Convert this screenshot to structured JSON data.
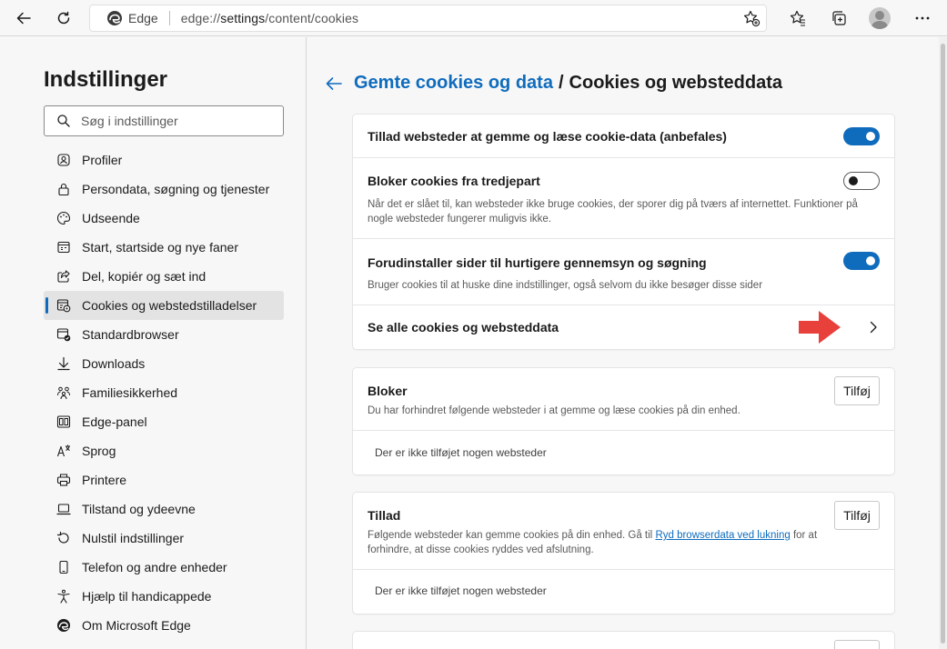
{
  "browser": {
    "address_brand": "Edge",
    "address_url_prefix": "edge://",
    "address_url_host": "settings",
    "address_url_path": "/content/cookies"
  },
  "sidebar": {
    "title": "Indstillinger",
    "search_placeholder": "Søg i indstillinger",
    "items": [
      {
        "label": "Profiler",
        "icon": "profile-icon"
      },
      {
        "label": "Persondata, søgning og tjenester",
        "icon": "lock-icon"
      },
      {
        "label": "Udseende",
        "icon": "palette-icon"
      },
      {
        "label": "Start, startside og nye faner",
        "icon": "new-tab-icon"
      },
      {
        "label": "Del, kopiér og sæt ind",
        "icon": "share-icon"
      },
      {
        "label": "Cookies og webstedstilladelser",
        "icon": "site-permissions-icon",
        "active": true
      },
      {
        "label": "Standardbrowser",
        "icon": "default-browser-icon"
      },
      {
        "label": "Downloads",
        "icon": "download-icon"
      },
      {
        "label": "Familiesikkerhed",
        "icon": "family-icon"
      },
      {
        "label": "Edge-panel",
        "icon": "sidebar-panel-icon"
      },
      {
        "label": "Sprog",
        "icon": "language-icon"
      },
      {
        "label": "Printere",
        "icon": "printer-icon"
      },
      {
        "label": "Tilstand og ydeevne",
        "icon": "laptop-icon"
      },
      {
        "label": "Nulstil indstillinger",
        "icon": "reset-icon"
      },
      {
        "label": "Telefon og andre enheder",
        "icon": "phone-icon"
      },
      {
        "label": "Hjælp til handicappede",
        "icon": "accessibility-icon"
      },
      {
        "label": "Om Microsoft Edge",
        "icon": "edge-logo-icon"
      }
    ]
  },
  "main": {
    "breadcrumb_parent": "Gemte cookies og data",
    "breadcrumb_separator": "/",
    "breadcrumb_current": "Cookies og websteddata",
    "settings": {
      "allow": {
        "label": "Tillad websteder at gemme og læse cookie-data (anbefales)",
        "enabled": true
      },
      "block_third_party": {
        "label": "Bloker cookies fra tredjepart",
        "description": "Når det er slået til, kan websteder ikke bruge cookies, der sporer dig på tværs af internettet. Funktioner på nogle websteder fungerer muligvis ikke.",
        "enabled": false
      },
      "preload": {
        "label": "Forudinstaller sider til hurtigere gennemsyn og søgning",
        "description": "Bruger cookies til at huske dine indstillinger, også selvom du ikke besøger disse sider",
        "enabled": true
      },
      "see_all": {
        "label": "Se alle cookies og websteddata"
      }
    },
    "block": {
      "title": "Bloker",
      "description": "Du har forhindret følgende websteder i at gemme og læse cookies på din enhed.",
      "add_label": "Tilføj",
      "empty_text": "Der er ikke tilføjet nogen websteder"
    },
    "allow": {
      "title": "Tillad",
      "description_before": "Følgende websteder kan gemme cookies på din enhed. Gå til ",
      "description_link": "Ryd browserdata ved lukning",
      "description_after": " for at forhindre, at disse cookies ryddes ved afslutning.",
      "add_label": "Tilføj",
      "empty_text": "Der er ikke tilføjet nogen websteder"
    }
  },
  "colors": {
    "accent": "#0f6cbd",
    "annotation_arrow": "#e8413c"
  }
}
